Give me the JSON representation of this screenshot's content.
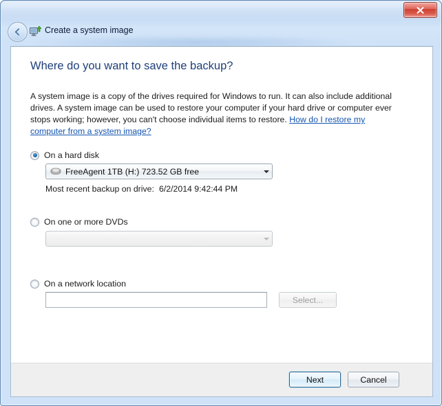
{
  "window": {
    "title": "Create a system image",
    "titlebar_icon": "system-image-monitor-icon",
    "back_button_icon": "back-arrow-icon",
    "close_button_label": "x",
    "accent_color": "#1f3f7a",
    "link_color": "#1455b0"
  },
  "page": {
    "heading": "Where do you want to save the backup?",
    "description_part1": "A system image is a copy of the drives required for Windows to run. It can also include additional drives. A system image can be used to restore your computer if your hard drive or computer ever stops working; however, you can't choose individual items to restore. ",
    "description_link": "How do I restore my computer from a system image?"
  },
  "options": {
    "hard_disk": {
      "label": "On a hard disk",
      "selected": true,
      "combo_value": "FreeAgent 1TB (H:)  723.52 GB free",
      "combo_icon": "hard-disk-icon",
      "recent_backup_label": "Most recent backup on drive:",
      "recent_backup_value": "6/2/2014 9:42:44 PM"
    },
    "dvds": {
      "label": "On one or more DVDs",
      "selected": false,
      "combo_value": "",
      "combo_disabled": true
    },
    "network": {
      "label": "On a network location",
      "selected": false,
      "textbox_value": "",
      "textbox_placeholder": "",
      "select_button_label": "Select...",
      "select_button_disabled": true
    }
  },
  "footer": {
    "next_label": "Next",
    "cancel_label": "Cancel"
  }
}
